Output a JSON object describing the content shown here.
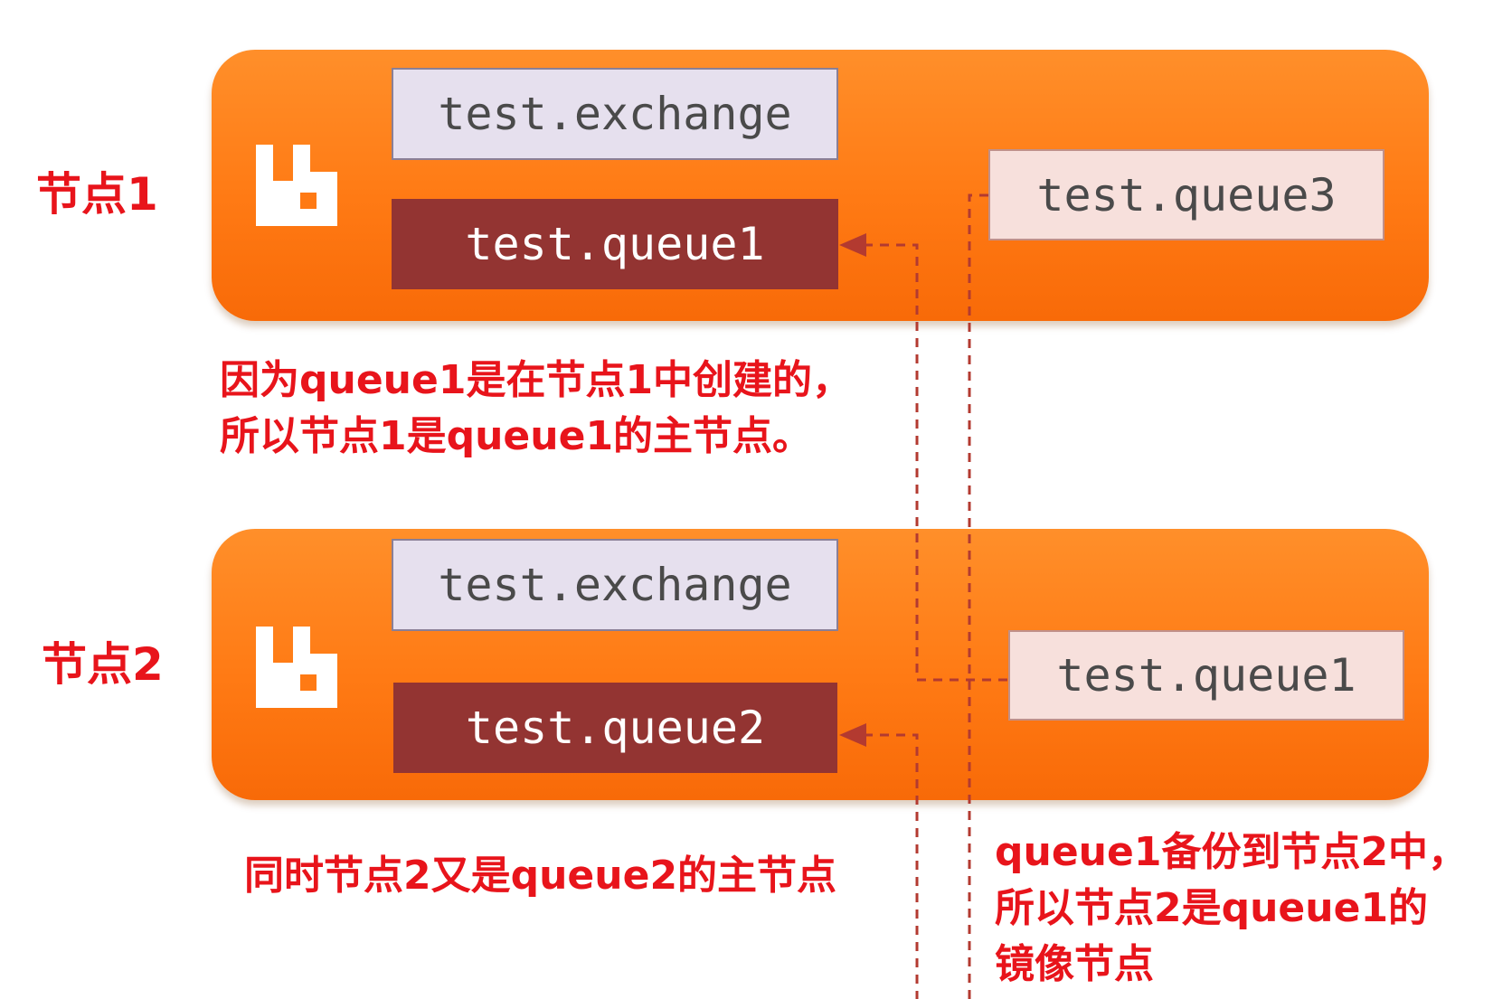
{
  "nodes": [
    {
      "label": "节点1",
      "exchange": "test.exchange",
      "master_queue": "test.queue1",
      "mirror_queue": "test.queue3"
    },
    {
      "label": "节点2",
      "exchange": "test.exchange",
      "master_queue": "test.queue2",
      "mirror_queue": "test.queue1"
    }
  ],
  "notes": {
    "node1_master": [
      "因为queue1是在节点1中创建的，",
      "所以节点1是queue1的主节点。"
    ],
    "node2_master": [
      "同时节点2又是queue2的主节点"
    ],
    "mirror": [
      "queue1备份到节点2中，",
      "所以节点2是queue1的",
      "镜像节点"
    ]
  },
  "colors": {
    "node_bg": "#ff7a14",
    "exchange_bg": "#e6e0ee",
    "master_queue_bg": "#933432",
    "mirror_queue_bg": "#f7e0dc",
    "annotation": "#e8141b",
    "connector": "#b33a30"
  },
  "icons": {
    "node_logo": "rabbitmq-logo-icon",
    "connector_arrow": "arrowhead-left-icon"
  }
}
